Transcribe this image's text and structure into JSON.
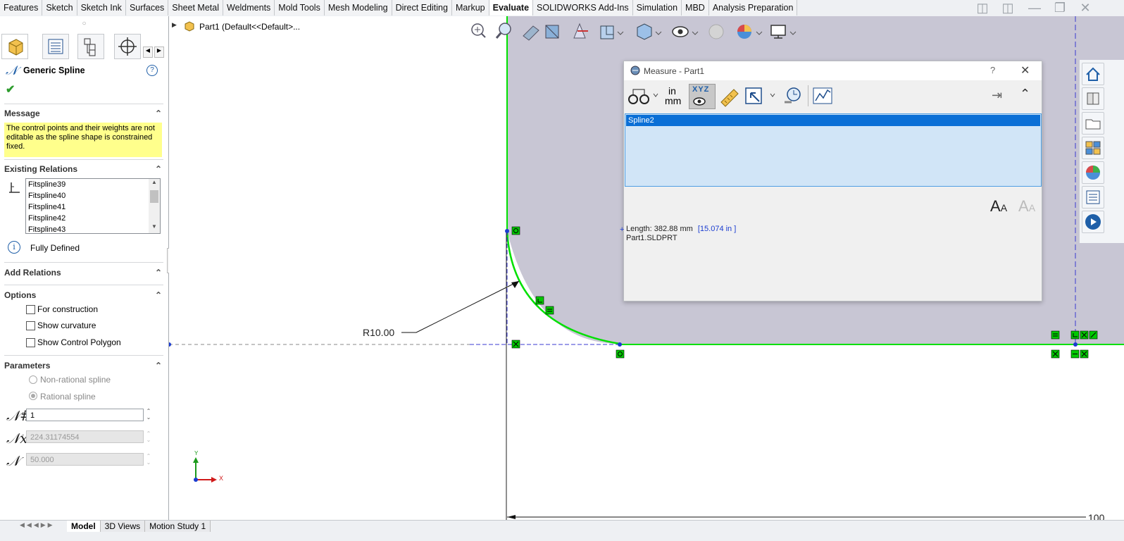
{
  "tabs": [
    "Features",
    "Sketch",
    "Sketch Ink",
    "Surfaces",
    "Sheet Metal",
    "Weldments",
    "Mold Tools",
    "Mesh Modeling",
    "Direct Editing",
    "Markup",
    "Evaluate",
    "SOLIDWORKS Add-Ins",
    "Simulation",
    "MBD",
    "Analysis Preparation"
  ],
  "active_tab": "Evaluate",
  "panel": {
    "title": "Generic Spline",
    "help": "?",
    "message_header": "Message",
    "message_text": "The control points and their weights are not editable as the spline shape is constrained fixed.",
    "existing_relations_header": "Existing Relations",
    "relations": [
      "Fitspline39",
      "Fitspline40",
      "Fitspline41",
      "Fitspline42",
      "Fitspline43"
    ],
    "status": "Fully Defined",
    "add_relations_header": "Add Relations",
    "options_header": "Options",
    "options": [
      "For construction",
      "Show curvature",
      "Show Control Polygon"
    ],
    "parameters_header": "Parameters",
    "radio_nonrational": "Non-rational spline",
    "radio_rational": "Rational spline",
    "param_degree": "1",
    "param_x": "224.31174554",
    "param_weight": "50.000",
    "message_bg": "#ffff8c"
  },
  "tree": {
    "root": "Part1  (Default<<Default>..."
  },
  "graphics": {
    "dimension_label": "R10.00",
    "partial_dim": "100",
    "axis_y": "Y",
    "axis_x": "X",
    "viewport_bg": "#c8c6d4",
    "spline_color": "#00e000"
  },
  "measure": {
    "title": "Measure - Part1",
    "help": "?",
    "unit_top": "in",
    "unit_bottom": "mm",
    "selection": "Spline2",
    "length_label": "Length: 382.88 mm",
    "length_alt": "[15.074 in ]",
    "file": "Part1.SLDPRT",
    "xyz_label": "XYZ"
  },
  "bottom_tabs": [
    "Model",
    "3D Views",
    "Motion Study 1"
  ],
  "active_bottom_tab": "Model"
}
